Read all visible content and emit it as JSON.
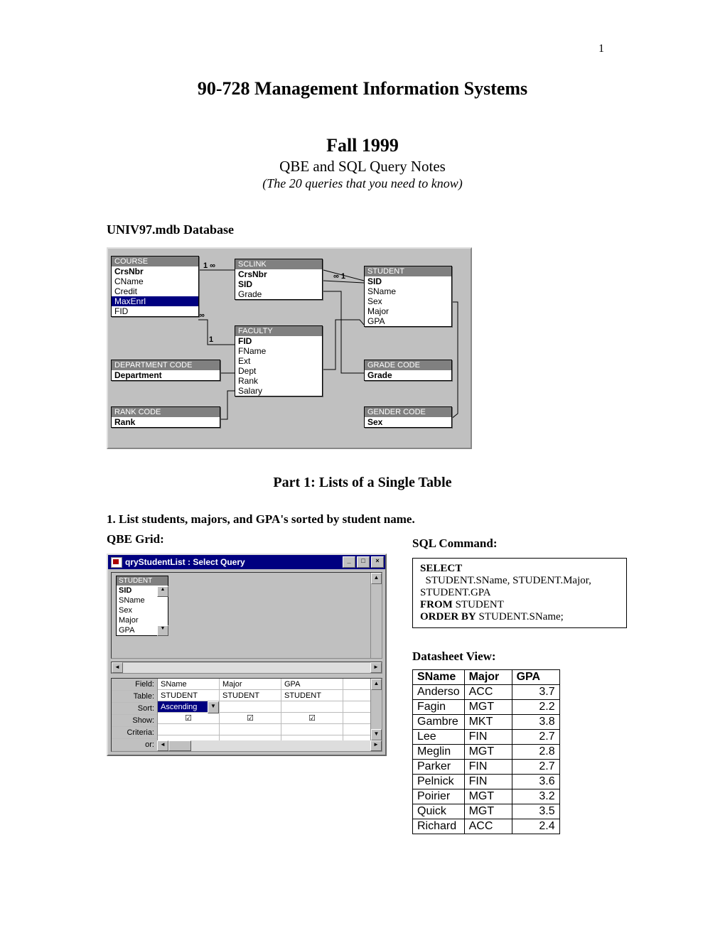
{
  "pagenum": "1",
  "title_line1": "90-728 Management Information Systems",
  "title_line2": "Fall 1999",
  "subtitle": "QBE and SQL Query Notes",
  "italic": "(The 20 queries that you need to know)",
  "db_label": "UNIV97.mdb Database",
  "schema": {
    "course": {
      "header": "COURSE",
      "fields": [
        "CrsNbr",
        "CName",
        "Credit",
        "MaxEnrl",
        "FID"
      ],
      "selected": "MaxEnrl",
      "bold": [
        "CrsNbr"
      ]
    },
    "sclink": {
      "header": "SCLINK",
      "fields": [
        "CrsNbr",
        "SID",
        "Grade"
      ],
      "bold": [
        "CrsNbr",
        "SID"
      ]
    },
    "student": {
      "header": "STUDENT",
      "fields": [
        "SID",
        "SName",
        "Sex",
        "Major",
        "GPA"
      ],
      "bold": [
        "SID"
      ]
    },
    "faculty": {
      "header": "FACULTY",
      "fields": [
        "FID",
        "FName",
        "Ext",
        "Dept",
        "Rank",
        "Salary"
      ],
      "bold": [
        "FID"
      ]
    },
    "deptcode": {
      "header": "DEPARTMENT CODE",
      "fields": [
        "Department"
      ],
      "bold": [
        "Department"
      ]
    },
    "gradecode": {
      "header": "GRADE CODE",
      "fields": [
        "Grade"
      ],
      "bold": [
        "Grade"
      ]
    },
    "rankcode": {
      "header": "RANK CODE",
      "fields": [
        "Rank"
      ],
      "bold": [
        "Rank"
      ]
    },
    "gendercode": {
      "header": "GENDER CODE",
      "fields": [
        "Sex"
      ],
      "bold": [
        "Sex"
      ]
    },
    "rel": {
      "one": "1",
      "inf": "∞",
      "one_inf": "1  ∞",
      "inf_one": "∞  1"
    }
  },
  "part_head": "Part 1: Lists of a Single Table",
  "item1": "1.   List students, majors, and GPA's sorted by student name.",
  "qbe_label": "QBE Grid:",
  "sql_label": "SQL Command:",
  "qbe": {
    "title": "qryStudentList : Select Query",
    "student": {
      "header": "STUDENT",
      "fields": [
        "SID",
        "SName",
        "Sex",
        "Major",
        "GPA"
      ],
      "bold": [
        "SID"
      ]
    },
    "rows": [
      "Field:",
      "Table:",
      "Sort:",
      "Show:",
      "Criteria:",
      "or:"
    ],
    "cols": [
      {
        "field": "SName",
        "table": "STUDENT",
        "sort": "Ascending",
        "show": true
      },
      {
        "field": "Major",
        "table": "STUDENT",
        "sort": "",
        "show": true
      },
      {
        "field": "GPA",
        "table": "STUDENT",
        "sort": "",
        "show": true
      },
      {
        "field": "",
        "table": "",
        "sort": "",
        "show": false
      }
    ]
  },
  "sql": {
    "select": "SELECT",
    "select_body": "STUDENT.SName, STUDENT.Major, STUDENT.GPA",
    "from": "FROM",
    "from_body": "STUDENT",
    "order": "ORDER BY",
    "order_body": "STUDENT.SName;"
  },
  "ds_label": "Datasheet View:",
  "ds": {
    "headers": [
      "SName",
      "Major",
      "GPA"
    ],
    "rows": [
      [
        "Anderso",
        "ACC",
        "3.7"
      ],
      [
        "Fagin",
        "MGT",
        "2.2"
      ],
      [
        "Gambre",
        "MKT",
        "3.8"
      ],
      [
        "Lee",
        "FIN",
        "2.7"
      ],
      [
        "Meglin",
        "MGT",
        "2.8"
      ],
      [
        "Parker",
        "FIN",
        "2.7"
      ],
      [
        "Pelnick",
        "FIN",
        "3.6"
      ],
      [
        "Poirier",
        "MGT",
        "3.2"
      ],
      [
        "Quick",
        "MGT",
        "3.5"
      ],
      [
        "Richard",
        "ACC",
        "2.4"
      ]
    ]
  }
}
